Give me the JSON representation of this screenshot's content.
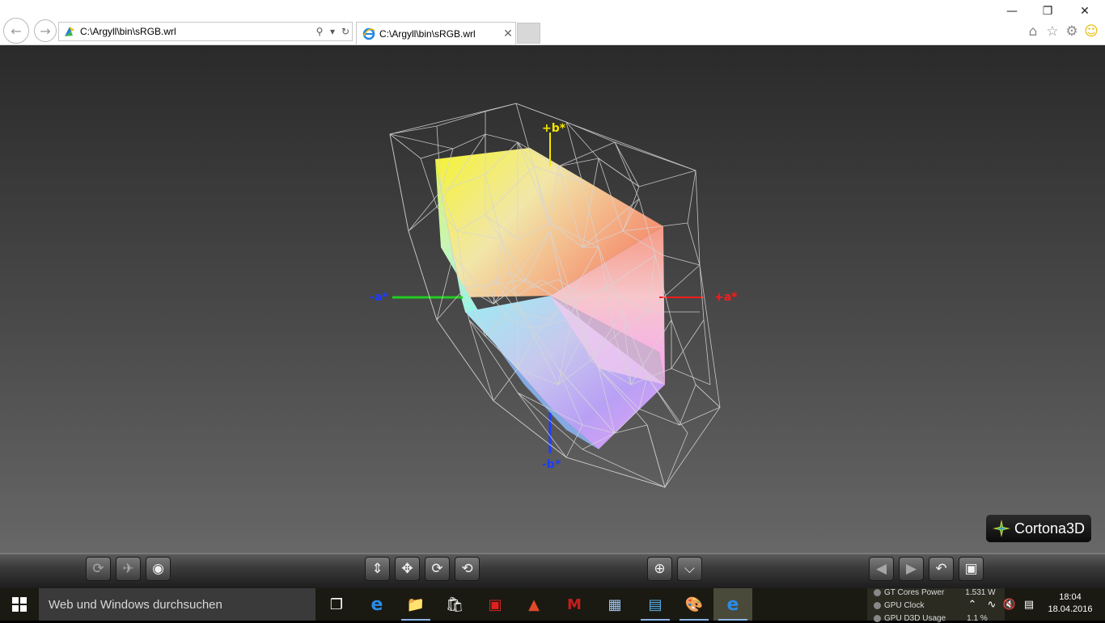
{
  "browser": {
    "address_url": "C:\\Argyll\\bin\\sRGB.wrl",
    "tab_title": "C:\\Argyll\\bin\\sRGB.wrl"
  },
  "viewer": {
    "axis_labels": {
      "b_plus": "+b*",
      "b_minus": "-b*",
      "a_minus": "-a*",
      "a_plus": "+a*"
    },
    "axis_colors": {
      "b_plus": "#f2e600",
      "b_minus": "#1f3cff",
      "a_minus": "#1f3cff",
      "a_plus": "#ff1a1a",
      "a_axis_line_left": "#22cc22"
    },
    "logo_text": "Cortona3D"
  },
  "toolbar": {
    "buttons": [
      {
        "icon": "walk-icon",
        "enabled": false
      },
      {
        "icon": "fly-icon",
        "enabled": false
      },
      {
        "icon": "study-eye-icon",
        "enabled": true
      },
      {
        "icon": "plan-arrows-icon",
        "enabled": true
      },
      {
        "icon": "pan-arrows-icon",
        "enabled": true
      },
      {
        "icon": "turn-icon",
        "enabled": true
      },
      {
        "icon": "roll-icon",
        "enabled": true
      },
      {
        "icon": "goto-target-icon",
        "enabled": true
      },
      {
        "icon": "align-icon",
        "enabled": true
      },
      {
        "icon": "previous-viewpoint-icon",
        "enabled": false
      },
      {
        "icon": "next-viewpoint-icon",
        "enabled": false
      },
      {
        "icon": "restore-icon",
        "enabled": true
      },
      {
        "icon": "fit-icon",
        "enabled": true
      }
    ]
  },
  "taskbar": {
    "search_placeholder": "Web und Windows durchsuchen",
    "hwinfo": {
      "rows": [
        {
          "label": "GT Cores Power",
          "value": "1.531 W"
        },
        {
          "label": "GPU Clock",
          "value": ""
        },
        {
          "label": "GPU D3D Usage",
          "value": "1.1 %"
        }
      ]
    },
    "clock_time": "18:04",
    "clock_date": "18.04.2016"
  }
}
